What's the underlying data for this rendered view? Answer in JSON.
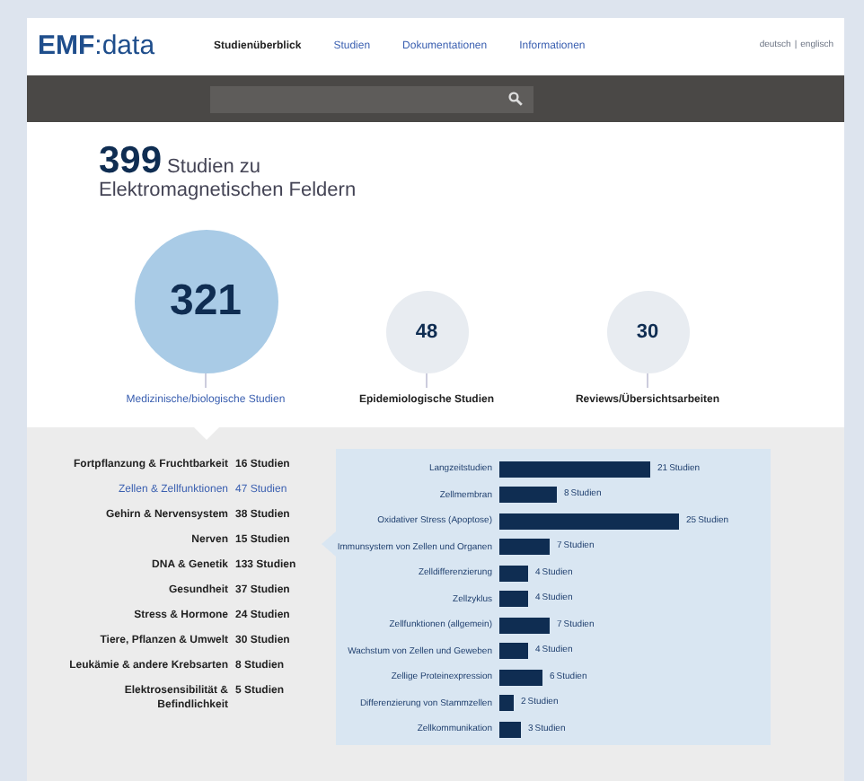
{
  "logo": {
    "brand": "EMF",
    "suffix": ":data"
  },
  "nav": [
    {
      "label": "Studienüberblick",
      "selected": true
    },
    {
      "label": "Studien",
      "selected": false
    },
    {
      "label": "Dokumentationen",
      "selected": false
    },
    {
      "label": "Informationen",
      "selected": false
    }
  ],
  "languages": {
    "items": [
      "deutsch",
      "englisch"
    ],
    "separator": "|"
  },
  "headline": {
    "count": "399",
    "lines": [
      "Studien zu",
      "Elektromagnetischen Feldern"
    ]
  },
  "categories": [
    {
      "count": "321",
      "label": "Medizinische/biologische Studien",
      "selected": true
    },
    {
      "count": "48",
      "label": "Epidemiologische Studien",
      "selected": false
    },
    {
      "count": "30",
      "label": "Reviews/Übersichtsarbeiten",
      "selected": false
    }
  ],
  "topics": [
    {
      "label": "Fortpflanzung & Fruchtbarkeit",
      "count": "16 Studien",
      "selected": false
    },
    {
      "label": "Zellen & Zellfunktionen",
      "count": "47 Studien",
      "selected": true
    },
    {
      "label": "Gehirn & Nervensystem",
      "count": "38 Studien",
      "selected": false
    },
    {
      "label": "Nerven",
      "count": "15 Studien",
      "selected": false
    },
    {
      "label": "DNA & Genetik",
      "count": "133 Studien",
      "selected": false
    },
    {
      "label": "Gesundheit",
      "count": "37 Studien",
      "selected": false
    },
    {
      "label": "Stress & Hormone",
      "count": "24 Studien",
      "selected": false
    },
    {
      "label": "Tiere, Pflanzen & Umwelt",
      "count": "30 Studien",
      "selected": false
    },
    {
      "label": "Leukämie & andere Krebsarten",
      "count": "8 Studien",
      "selected": false
    },
    {
      "label": "Elektrosensibilität & Befindlichkeit",
      "count": "5 Studien",
      "selected": false
    }
  ],
  "chart_data": {
    "type": "bar",
    "orientation": "horizontal",
    "data_labels": true,
    "categories": [
      "Langzeitstudien",
      "Zellmembran",
      "Oxidativer Stress (Apoptose)",
      "Immunsystem von Zellen und Organen",
      "Zelldifferenzierung",
      "Zellzyklus",
      "Zellfunktionen (allgemein)",
      "Wachstum von Zellen und Geweben",
      "Zellige Proteinexpression",
      "Differenzierung von Stammzellen",
      "Zellkommunikation"
    ],
    "series": [
      {
        "name": "Studien",
        "color": "#0f2d52",
        "values": [
          21,
          8,
          25,
          7,
          4,
          4,
          7,
          4,
          6,
          2,
          3
        ]
      }
    ]
  }
}
